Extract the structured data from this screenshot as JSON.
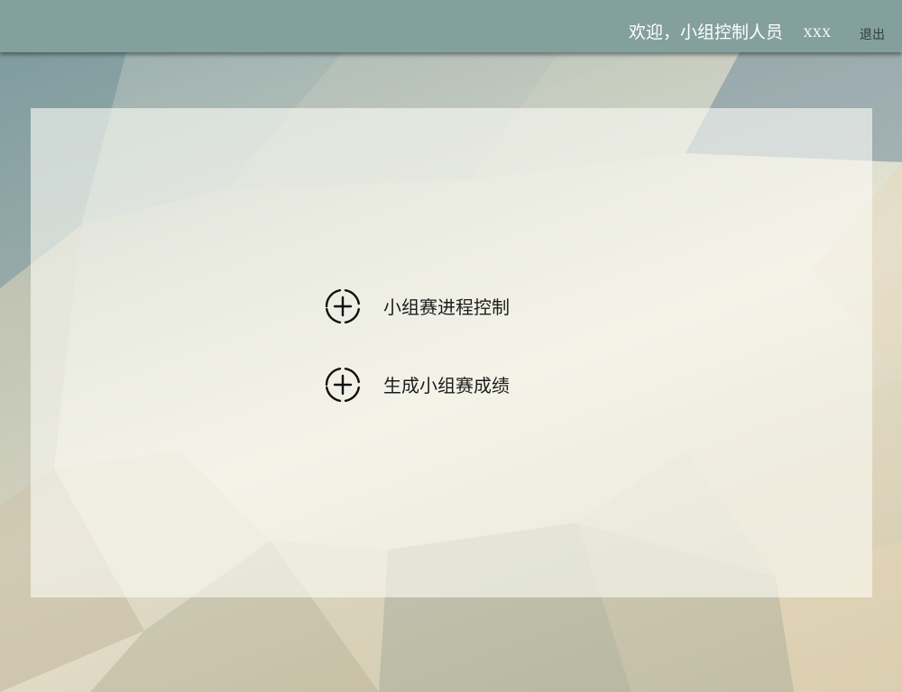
{
  "header": {
    "welcome_text": "欢迎，小组控制人员",
    "username": "XXX",
    "logout_label": "退出"
  },
  "menu": {
    "items": [
      {
        "label": "小组赛进程控制",
        "icon": "add-circle-icon"
      },
      {
        "label": "生成小组赛成绩",
        "icon": "add-circle-icon"
      }
    ]
  },
  "colors": {
    "header_bg": "#83a09c",
    "header_text": "#ffffff",
    "logout_text": "#2f3a38",
    "panel_bg": "rgba(250,250,244,0.62)",
    "menu_text": "#1c1c1c"
  }
}
